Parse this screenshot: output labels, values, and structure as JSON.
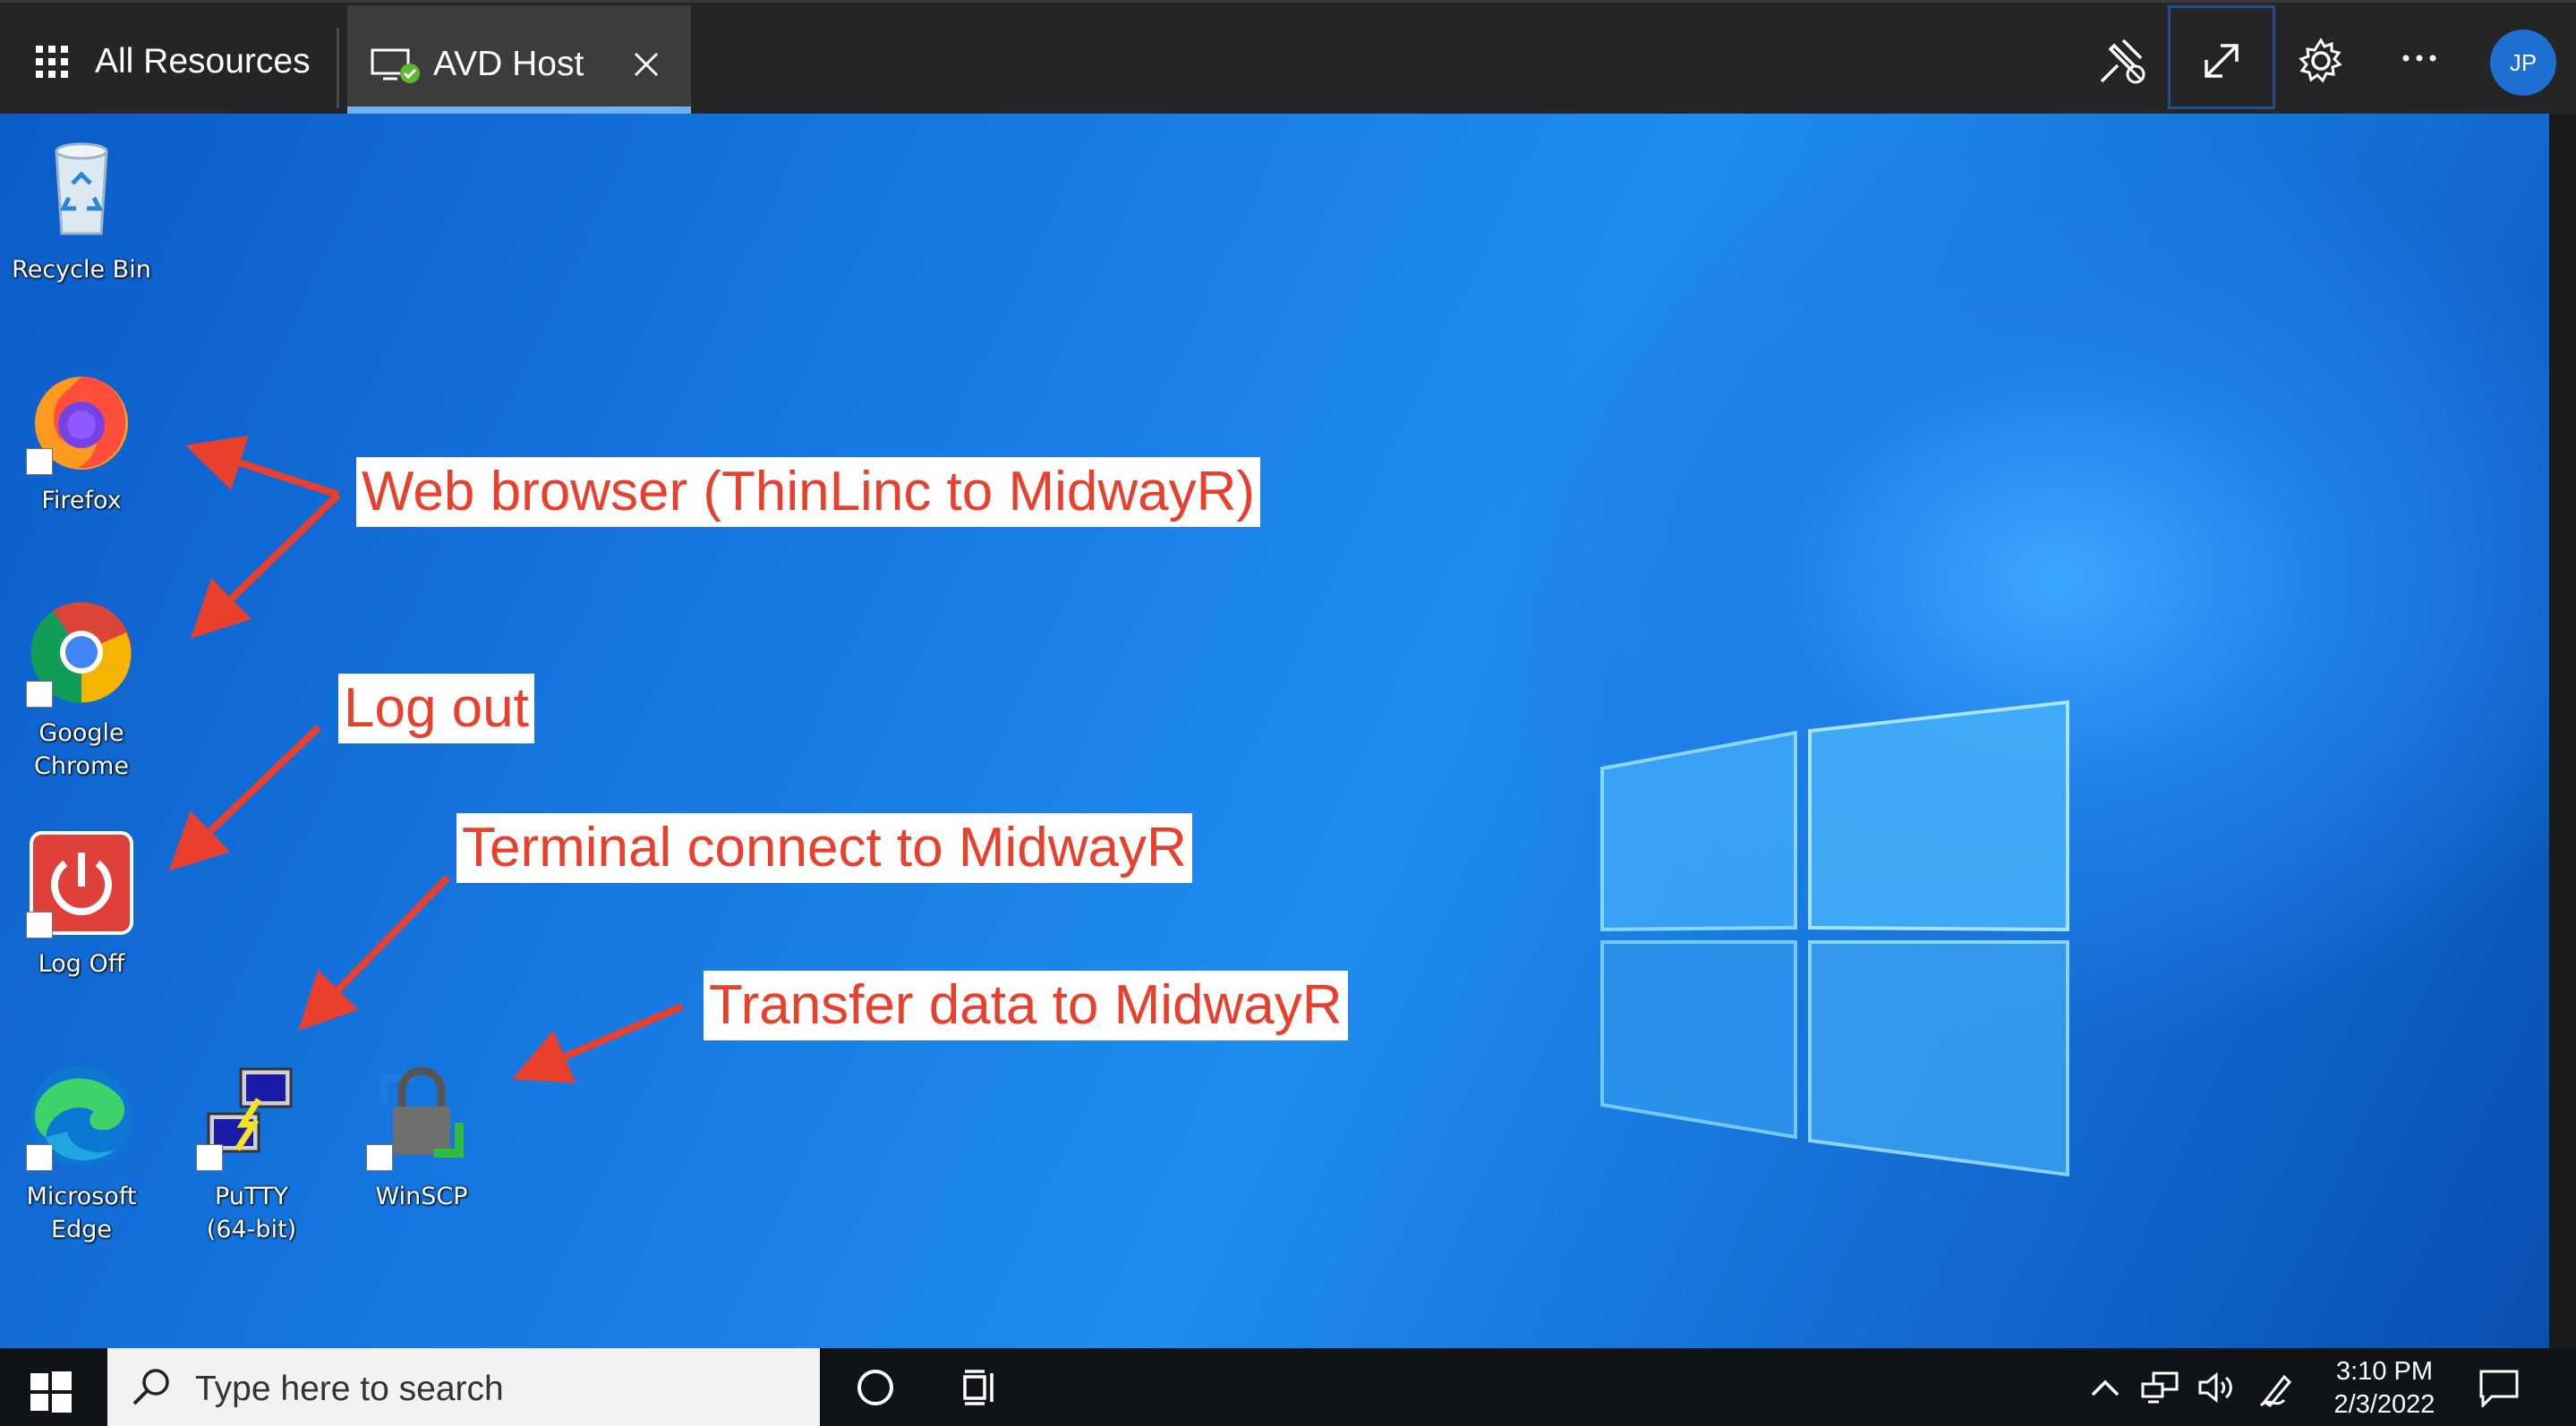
{
  "topbar": {
    "all_resources_label": "All Resources",
    "tab_title": "AVD Host",
    "user_initials": "JP",
    "icons": [
      "waffle-icon",
      "remote-desktop-monitor-icon",
      "close-icon",
      "unpin-icon",
      "expand-icon",
      "gear-icon",
      "more-icon"
    ]
  },
  "desktop": {
    "icons": [
      {
        "label": "Recycle Bin",
        "icon": "recycle-bin-icon"
      },
      {
        "label": "Firefox",
        "icon": "firefox-icon"
      },
      {
        "label": "Google Chrome",
        "icon": "chrome-icon"
      },
      {
        "label": "Log Off",
        "icon": "power-icon"
      },
      {
        "label": "Microsoft Edge",
        "icon": "edge-icon"
      },
      {
        "label": "PuTTY (64-bit)",
        "icon": "putty-icon"
      },
      {
        "label": "WinSCP",
        "icon": "winscp-icon"
      }
    ],
    "annotations": {
      "browser": "Web browser (ThinLinc to MidwayR)",
      "logout": "Log out",
      "terminal": "Terminal connect to MidwayR",
      "transfer": "Transfer data to MidwayR"
    },
    "annotation_color": "#e8402d"
  },
  "taskbar": {
    "search_placeholder": "Type here to search",
    "time": "3:10 PM",
    "date": "2/3/2022",
    "icons": [
      "windows-start-icon",
      "search-icon",
      "cortana-icon",
      "task-view-icon",
      "chevron-up-icon",
      "network-icon",
      "volume-icon",
      "pen-icon",
      "notification-icon"
    ]
  },
  "colors": {
    "topbar": "#252526",
    "tab_accent": "#6fb4f0",
    "avatar": "#1d6fd1",
    "taskbar": "#101418"
  }
}
